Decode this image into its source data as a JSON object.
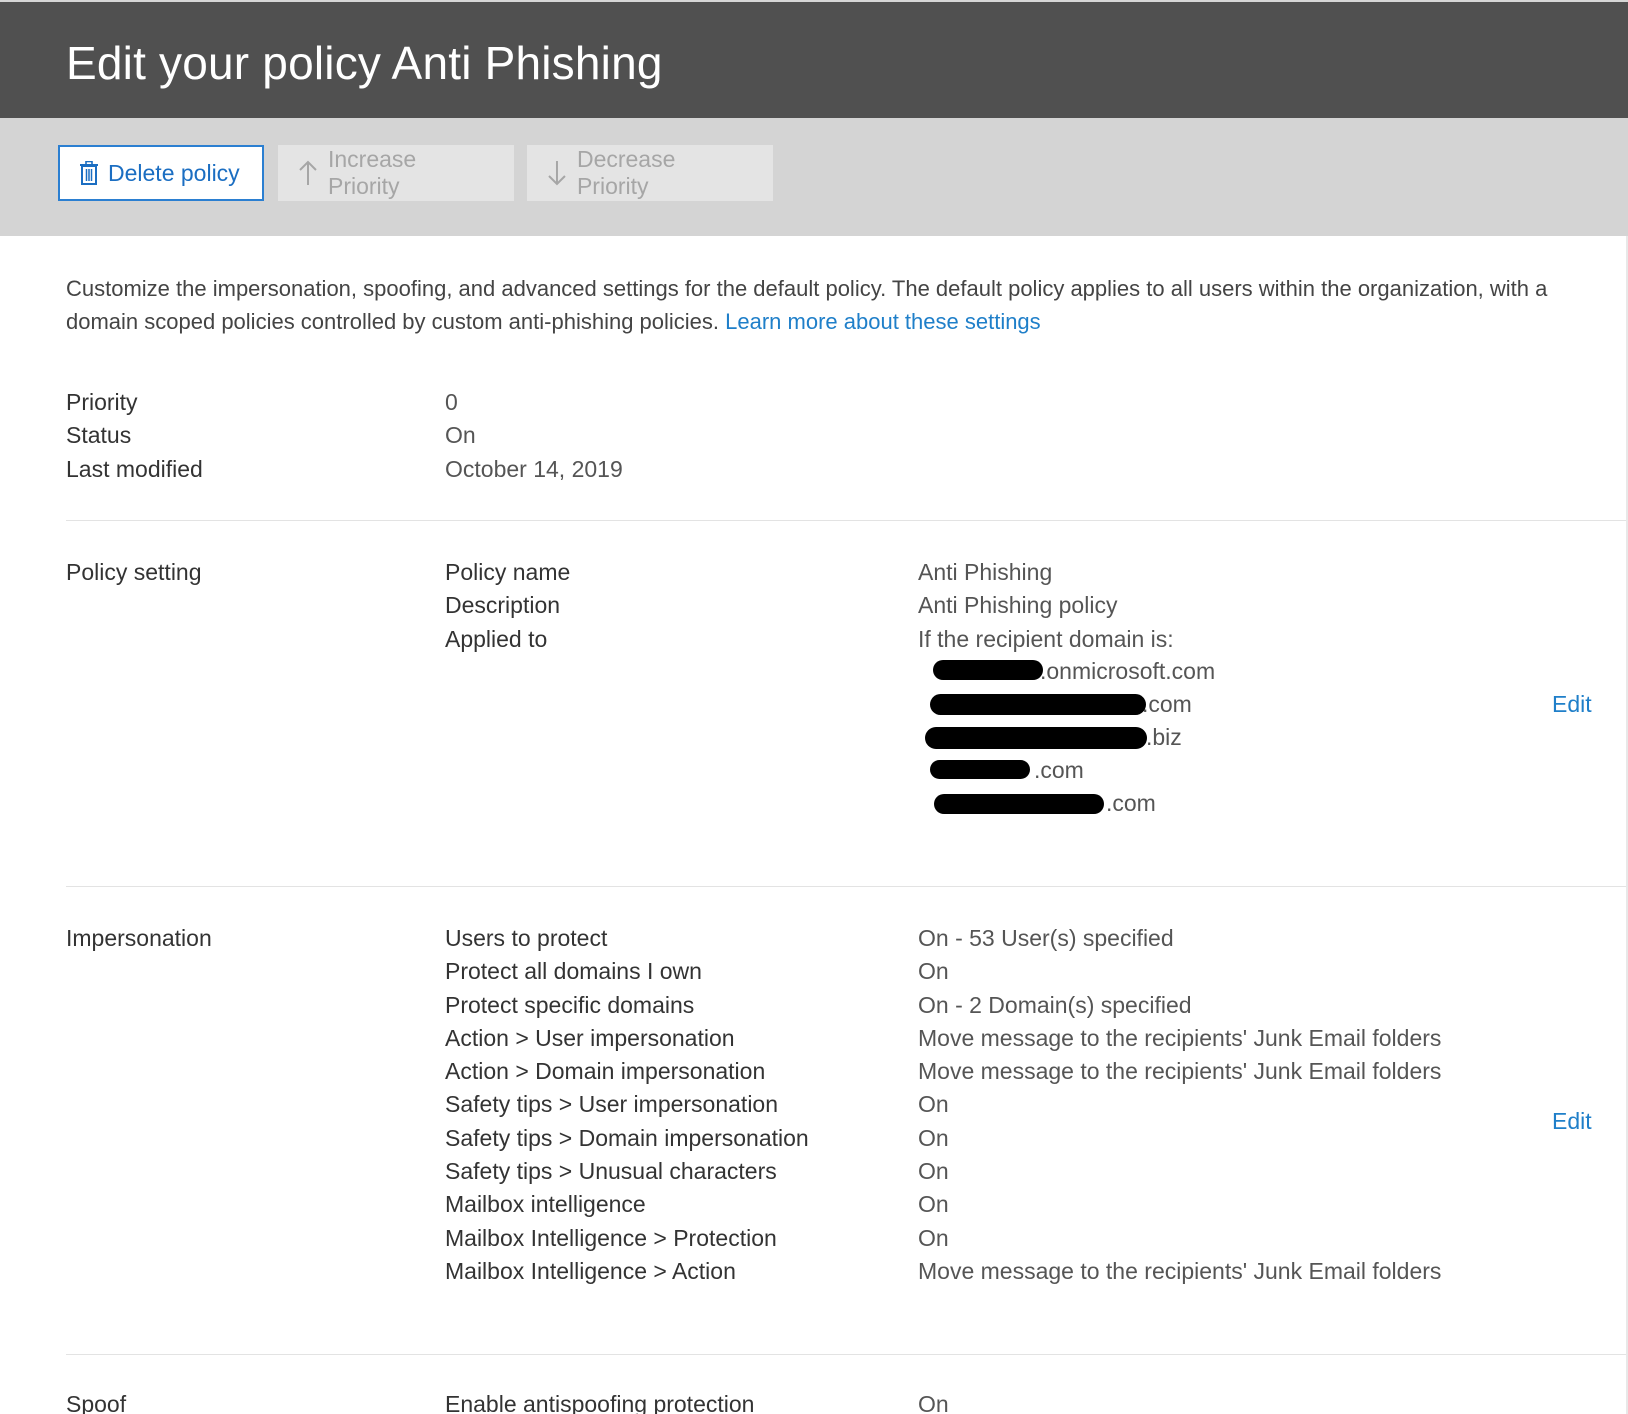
{
  "header": {
    "title": "Edit your policy Anti Phishing"
  },
  "toolbar": {
    "delete_label": "Delete policy",
    "increase_label": "Increase Priority",
    "decrease_label": "Decrease Priority"
  },
  "intro": {
    "line1": "Customize the impersonation, spoofing, and advanced settings for the default policy. The default policy applies to all users within the organization, with a",
    "line2": "domain scoped policies controlled by custom anti-phishing policies. ",
    "link": "Learn more about these settings"
  },
  "summary": {
    "rows": [
      {
        "label": "Priority",
        "value": "0"
      },
      {
        "label": "Status",
        "value": "On"
      },
      {
        "label": "Last modified",
        "value": "October 14, 2019"
      }
    ]
  },
  "policy_setting": {
    "section": "Policy setting",
    "rows": [
      {
        "label": "Policy name",
        "value": "Anti Phishing"
      },
      {
        "label": "Description",
        "value": "Anti Phishing policy"
      },
      {
        "label": "Applied to",
        "value": "If the recipient domain is:"
      }
    ],
    "domains": [
      ".onmicrosoft.com",
      ".com",
      ".biz",
      ".com",
      ".com"
    ],
    "edit": "Edit"
  },
  "impersonation": {
    "section": "Impersonation",
    "rows": [
      {
        "label": "Users to protect",
        "value": "On - 53 User(s) specified"
      },
      {
        "label": "Protect all domains I own",
        "value": "On"
      },
      {
        "label": "Protect specific domains",
        "value": "On - 2 Domain(s) specified"
      },
      {
        "label": "Action > User impersonation",
        "value": "Move message to the recipients' Junk Email folders"
      },
      {
        "label": "Action > Domain impersonation",
        "value": "Move message to the recipients' Junk Email folders"
      },
      {
        "label": "Safety tips > User impersonation",
        "value": "On"
      },
      {
        "label": "Safety tips > Domain impersonation",
        "value": "On"
      },
      {
        "label": "Safety tips > Unusual characters",
        "value": "On"
      },
      {
        "label": "Mailbox intelligence",
        "value": "On"
      },
      {
        "label": "Mailbox Intelligence > Protection",
        "value": "On"
      },
      {
        "label": "Mailbox Intelligence > Action",
        "value": "Move message to the recipients' Junk Email folders"
      }
    ],
    "edit": "Edit"
  },
  "spoof": {
    "section": "Spoof",
    "rows": [
      {
        "label": "Enable antispoofing protection",
        "value": "On"
      }
    ]
  },
  "colors": {
    "header_bg": "#505050",
    "toolbar_bg": "#d4d4d4",
    "link": "#1f7fc9",
    "accent": "#2b7fd1"
  }
}
